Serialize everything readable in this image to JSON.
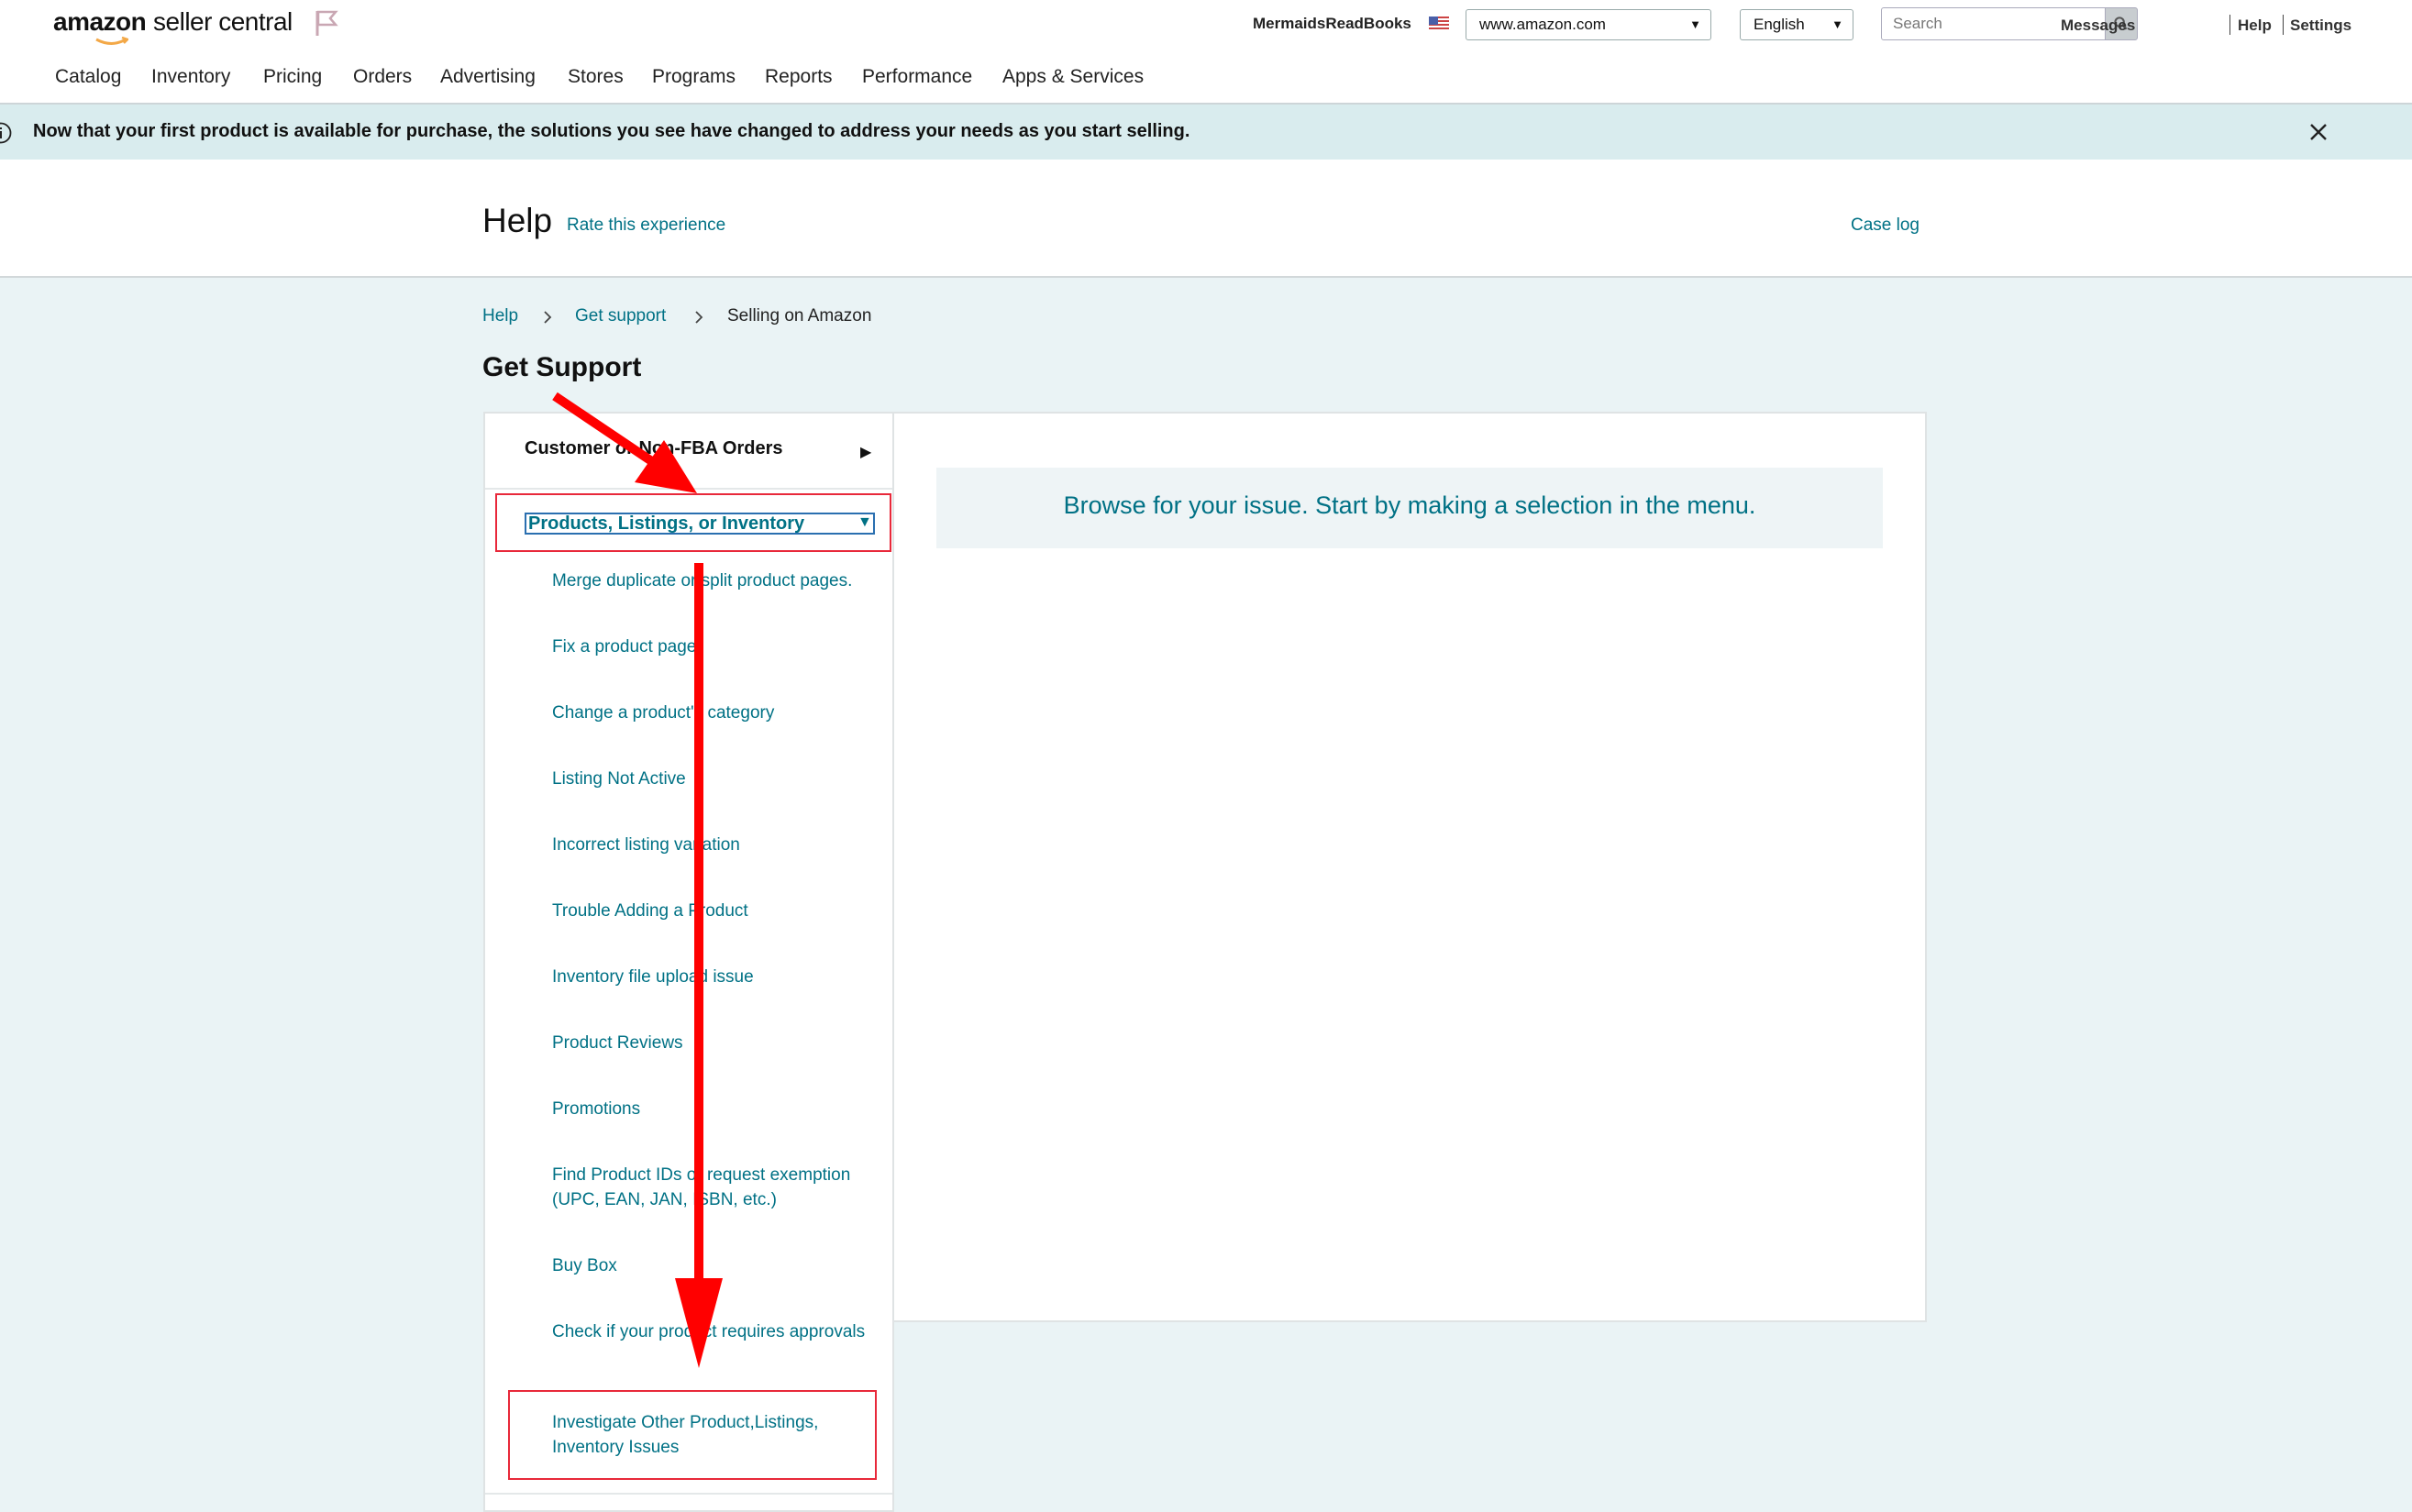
{
  "header": {
    "logo_text": "amazon",
    "logo_sub": "seller central",
    "store_name": "MermaidsReadBooks",
    "marketplace": "www.amazon.com",
    "language": "English",
    "search_placeholder": "Search",
    "links": [
      "Messages",
      "Help",
      "Settings"
    ],
    "nav": [
      "Catalog",
      "Inventory",
      "Pricing",
      "Orders",
      "Advertising",
      "Stores",
      "Programs",
      "Reports",
      "Performance",
      "Apps & Services"
    ]
  },
  "banner": {
    "text": "Now that your first product is available for purchase, the solutions you see have changed to address your needs as you start selling."
  },
  "help_header": {
    "title": "Help",
    "rate_link": "Rate this experience",
    "case_log": "Case log"
  },
  "breadcrumb": [
    "Help",
    "Get support",
    "Selling on Amazon"
  ],
  "page_title": "Get Support",
  "menu": {
    "collapsed_item": "Customer or Non-FBA Orders",
    "selected_category": "Products, Listings, or Inventory",
    "subitems": [
      "Merge duplicate or split product pages.",
      "Fix a product page",
      "Change a product's category",
      "Listing Not Active",
      "Incorrect listing variation",
      "Trouble Adding a Product",
      "Inventory file upload issue",
      "Product Reviews",
      "Promotions",
      "Find Product IDs or request exemption (UPC, EAN, JAN, ISBN, etc.)",
      "Buy Box",
      "Check if your product requires approvals",
      "Investigate Other Product,Listings, Inventory Issues"
    ]
  },
  "main": {
    "browse_prompt": "Browse for your issue. Start by making a selection in the menu."
  },
  "colors": {
    "link": "#007185",
    "annotation_red": "#e8283a",
    "banner_bg": "#d9ecee",
    "page_bg": "#eaf3f5"
  },
  "icons": [
    "flag-icon",
    "us-flag-icon",
    "search-icon",
    "info-icon",
    "close-icon",
    "chevron-right-icon",
    "triangle-right-icon",
    "triangle-down-icon"
  ]
}
